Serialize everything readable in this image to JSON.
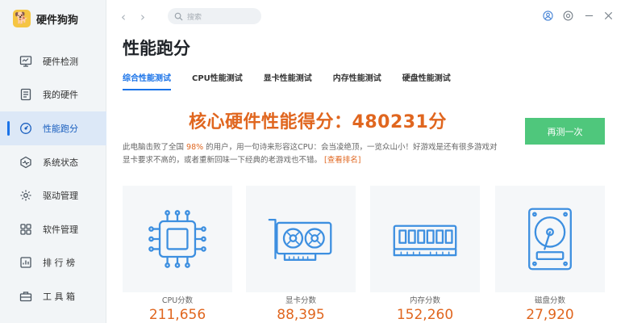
{
  "app": {
    "name": "硬件狗狗",
    "logo_icon": "dog-logo-icon"
  },
  "sidebar": {
    "items": [
      {
        "label": "硬件检测",
        "icon": "monitor-icon",
        "active": false
      },
      {
        "label": "我的硬件",
        "icon": "document-icon",
        "active": false
      },
      {
        "label": "性能跑分",
        "icon": "speedometer-icon",
        "active": true
      },
      {
        "label": "系统状态",
        "icon": "pulse-icon",
        "active": false
      },
      {
        "label": "驱动管理",
        "icon": "gear-icon",
        "active": false
      },
      {
        "label": "软件管理",
        "icon": "apps-icon",
        "active": false
      },
      {
        "label": "排 行 榜",
        "icon": "ranking-icon",
        "active": false
      },
      {
        "label": "工 具 箱",
        "icon": "toolbox-icon",
        "active": false
      }
    ]
  },
  "topbar": {
    "back_icon": "‹",
    "forward_icon": "›",
    "search_placeholder": "搜索",
    "tools": [
      "user-icon",
      "settings-icon",
      "minimize-icon",
      "close-icon"
    ]
  },
  "page": {
    "title": "性能跑分",
    "tabs": [
      {
        "label": "综合性能测试",
        "active": true
      },
      {
        "label": "CPU性能测试",
        "active": false
      },
      {
        "label": "显卡性能测试",
        "active": false
      },
      {
        "label": "内存性能测试",
        "active": false
      },
      {
        "label": "硬盘性能测试",
        "active": false
      }
    ],
    "score_label": "核心硬件性能得分：",
    "score_value": "480231分",
    "retest_label": "再测一次",
    "desc_part1": "此电脑击败了全国 ",
    "desc_percent": "98%",
    "desc_part2": " 的用户，用一句诗来形容这CPU：会当凌绝顶，一览众山小！好游戏是还有很多游戏对显卡要求不高的，或者重新回味一下经典的老游戏也不错。",
    "desc_link": "[查看排名]"
  },
  "cards": [
    {
      "label": "CPU分数",
      "value": "211,656",
      "icon": "cpu-chip-icon"
    },
    {
      "label": "显卡分数",
      "value": "88,395",
      "icon": "graphics-card-icon"
    },
    {
      "label": "内存分数",
      "value": "152,260",
      "icon": "memory-stick-icon"
    },
    {
      "label": "磁盘分数",
      "value": "27,920",
      "icon": "hard-disk-icon"
    }
  ],
  "colors": {
    "accent": "#1a73e8",
    "score": "#e0661f",
    "retest": "#4fc77c",
    "icon_stroke": "#3d8fe0"
  }
}
